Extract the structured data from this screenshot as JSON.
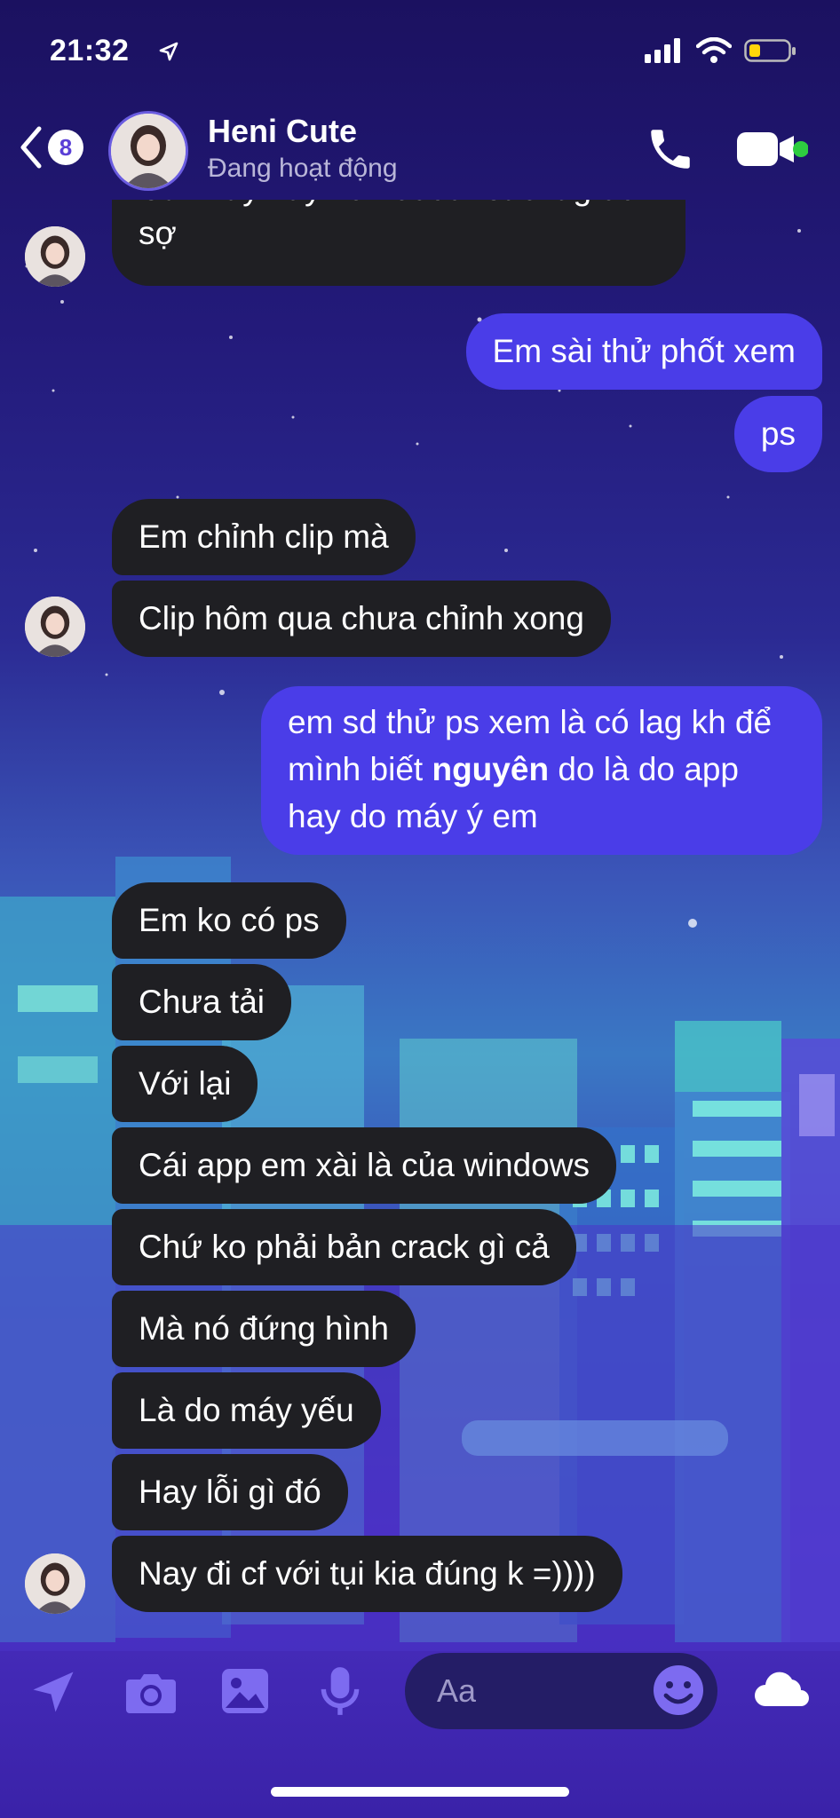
{
  "status_bar": {
    "time": "21:32"
  },
  "header": {
    "unread_count": "8",
    "contact_name": "Heni Cute",
    "activity_status": "Đang hoạt động"
  },
  "messages": [
    {
      "side": "in",
      "text": "Cái máy này ko hoeeur sao lag dễ sợ"
    },
    {
      "side": "out",
      "text": "Em sài thử phốt xem"
    },
    {
      "side": "out",
      "text": "ps"
    },
    {
      "side": "in",
      "text": "Em chỉnh clip mà"
    },
    {
      "side": "in",
      "text": "Clip hôm qua chưa chỉnh xong"
    },
    {
      "side": "out",
      "text_before": "em sd thử ps xem là có lag kh để mình biết ",
      "text_bold": "nguyên",
      "text_after": " do là do app hay do máy ý em"
    },
    {
      "side": "in",
      "text": "Em ko có ps"
    },
    {
      "side": "in",
      "text": "Chưa tải"
    },
    {
      "side": "in",
      "text": "Với lại"
    },
    {
      "side": "in",
      "text": "Cái app em xài là của windows"
    },
    {
      "side": "in",
      "text": "Chứ ko phải bản crack gì cả"
    },
    {
      "side": "in",
      "text": "Mà nó đứng hình"
    },
    {
      "side": "in",
      "text": "Là do máy yếu"
    },
    {
      "side": "in",
      "text": "Hay lỗi gì đó"
    },
    {
      "side": "in",
      "text": "Nay đi cf với tụi kia đúng k =))))"
    }
  ],
  "composer": {
    "placeholder": "Aa",
    "icons": [
      "location-icon",
      "camera-icon",
      "gallery-icon",
      "microphone-icon",
      "emoji-icon",
      "cloud-icon"
    ]
  },
  "colors": {
    "outgoing_bubble": "#4a3de8",
    "incoming_bubble": "#1f1f23",
    "online_dot": "#2ecc40",
    "accent": "#5a3fd6"
  }
}
